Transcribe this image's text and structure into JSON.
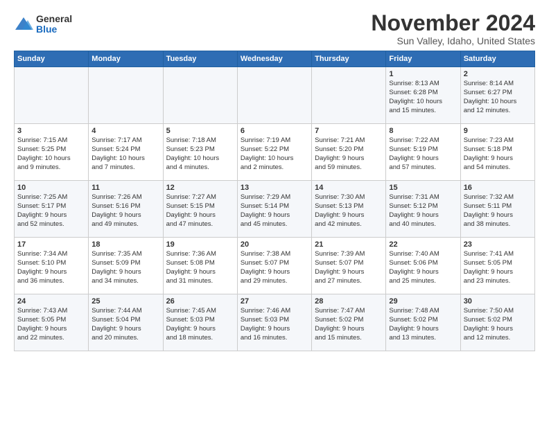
{
  "logo": {
    "general": "General",
    "blue": "Blue"
  },
  "title": "November 2024",
  "subtitle": "Sun Valley, Idaho, United States",
  "header_days": [
    "Sunday",
    "Monday",
    "Tuesday",
    "Wednesday",
    "Thursday",
    "Friday",
    "Saturday"
  ],
  "weeks": [
    [
      {
        "day": "",
        "info": ""
      },
      {
        "day": "",
        "info": ""
      },
      {
        "day": "",
        "info": ""
      },
      {
        "day": "",
        "info": ""
      },
      {
        "day": "",
        "info": ""
      },
      {
        "day": "1",
        "info": "Sunrise: 8:13 AM\nSunset: 6:28 PM\nDaylight: 10 hours\nand 15 minutes."
      },
      {
        "day": "2",
        "info": "Sunrise: 8:14 AM\nSunset: 6:27 PM\nDaylight: 10 hours\nand 12 minutes."
      }
    ],
    [
      {
        "day": "3",
        "info": "Sunrise: 7:15 AM\nSunset: 5:25 PM\nDaylight: 10 hours\nand 9 minutes."
      },
      {
        "day": "4",
        "info": "Sunrise: 7:17 AM\nSunset: 5:24 PM\nDaylight: 10 hours\nand 7 minutes."
      },
      {
        "day": "5",
        "info": "Sunrise: 7:18 AM\nSunset: 5:23 PM\nDaylight: 10 hours\nand 4 minutes."
      },
      {
        "day": "6",
        "info": "Sunrise: 7:19 AM\nSunset: 5:22 PM\nDaylight: 10 hours\nand 2 minutes."
      },
      {
        "day": "7",
        "info": "Sunrise: 7:21 AM\nSunset: 5:20 PM\nDaylight: 9 hours\nand 59 minutes."
      },
      {
        "day": "8",
        "info": "Sunrise: 7:22 AM\nSunset: 5:19 PM\nDaylight: 9 hours\nand 57 minutes."
      },
      {
        "day": "9",
        "info": "Sunrise: 7:23 AM\nSunset: 5:18 PM\nDaylight: 9 hours\nand 54 minutes."
      }
    ],
    [
      {
        "day": "10",
        "info": "Sunrise: 7:25 AM\nSunset: 5:17 PM\nDaylight: 9 hours\nand 52 minutes."
      },
      {
        "day": "11",
        "info": "Sunrise: 7:26 AM\nSunset: 5:16 PM\nDaylight: 9 hours\nand 49 minutes."
      },
      {
        "day": "12",
        "info": "Sunrise: 7:27 AM\nSunset: 5:15 PM\nDaylight: 9 hours\nand 47 minutes."
      },
      {
        "day": "13",
        "info": "Sunrise: 7:29 AM\nSunset: 5:14 PM\nDaylight: 9 hours\nand 45 minutes."
      },
      {
        "day": "14",
        "info": "Sunrise: 7:30 AM\nSunset: 5:13 PM\nDaylight: 9 hours\nand 42 minutes."
      },
      {
        "day": "15",
        "info": "Sunrise: 7:31 AM\nSunset: 5:12 PM\nDaylight: 9 hours\nand 40 minutes."
      },
      {
        "day": "16",
        "info": "Sunrise: 7:32 AM\nSunset: 5:11 PM\nDaylight: 9 hours\nand 38 minutes."
      }
    ],
    [
      {
        "day": "17",
        "info": "Sunrise: 7:34 AM\nSunset: 5:10 PM\nDaylight: 9 hours\nand 36 minutes."
      },
      {
        "day": "18",
        "info": "Sunrise: 7:35 AM\nSunset: 5:09 PM\nDaylight: 9 hours\nand 34 minutes."
      },
      {
        "day": "19",
        "info": "Sunrise: 7:36 AM\nSunset: 5:08 PM\nDaylight: 9 hours\nand 31 minutes."
      },
      {
        "day": "20",
        "info": "Sunrise: 7:38 AM\nSunset: 5:07 PM\nDaylight: 9 hours\nand 29 minutes."
      },
      {
        "day": "21",
        "info": "Sunrise: 7:39 AM\nSunset: 5:07 PM\nDaylight: 9 hours\nand 27 minutes."
      },
      {
        "day": "22",
        "info": "Sunrise: 7:40 AM\nSunset: 5:06 PM\nDaylight: 9 hours\nand 25 minutes."
      },
      {
        "day": "23",
        "info": "Sunrise: 7:41 AM\nSunset: 5:05 PM\nDaylight: 9 hours\nand 23 minutes."
      }
    ],
    [
      {
        "day": "24",
        "info": "Sunrise: 7:43 AM\nSunset: 5:05 PM\nDaylight: 9 hours\nand 22 minutes."
      },
      {
        "day": "25",
        "info": "Sunrise: 7:44 AM\nSunset: 5:04 PM\nDaylight: 9 hours\nand 20 minutes."
      },
      {
        "day": "26",
        "info": "Sunrise: 7:45 AM\nSunset: 5:03 PM\nDaylight: 9 hours\nand 18 minutes."
      },
      {
        "day": "27",
        "info": "Sunrise: 7:46 AM\nSunset: 5:03 PM\nDaylight: 9 hours\nand 16 minutes."
      },
      {
        "day": "28",
        "info": "Sunrise: 7:47 AM\nSunset: 5:02 PM\nDaylight: 9 hours\nand 15 minutes."
      },
      {
        "day": "29",
        "info": "Sunrise: 7:48 AM\nSunset: 5:02 PM\nDaylight: 9 hours\nand 13 minutes."
      },
      {
        "day": "30",
        "info": "Sunrise: 7:50 AM\nSunset: 5:02 PM\nDaylight: 9 hours\nand 12 minutes."
      }
    ]
  ]
}
